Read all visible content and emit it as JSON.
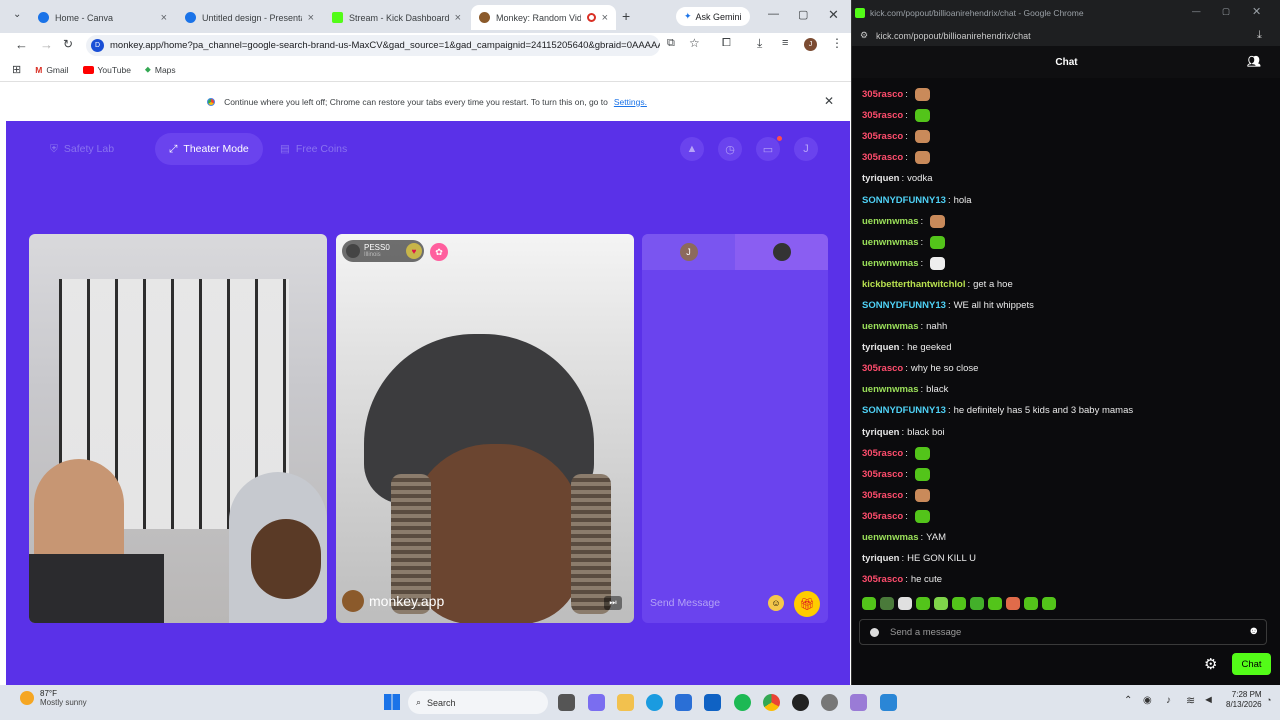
{
  "left_browser": {
    "tabs": [
      {
        "label": "Home - Canva",
        "color": "#1a73e8"
      },
      {
        "label": "Untitled design - Presentatio",
        "color": "#1a73e8"
      },
      {
        "label": "Stream - Kick Dashboard",
        "color": "#53fc18"
      },
      {
        "label": "Monkey: Random Video",
        "color": "#8b5a2b"
      }
    ],
    "new_tab": "+",
    "ask_gemini": "Ask Gemini",
    "url": "monkey.app/home?pa_channel=google-search-brand-us-MaxCV&gad_source=1&gad_campaignid=24115205640&gbraid=0AAAAA...",
    "bookmarks": [
      "Gmail",
      "YouTube",
      "Maps"
    ],
    "infobar": {
      "text": "Continue where you left off; Chrome can restore your tabs every time you restart. To turn this on, go to",
      "link": "Settings."
    }
  },
  "monkey": {
    "safety_lab": "Safety Lab",
    "theater_mode": "Theater Mode",
    "free_coins": "Free Coins",
    "avatar_letter": "J",
    "peer": {
      "name": "PESS0",
      "location": "Illinois"
    },
    "watermark": "monkey.app",
    "chat_avatar_letter": "J",
    "send_placeholder": "Send Message",
    "colors": {
      "bg": "#5a31e8",
      "panel": "#6a43ee"
    }
  },
  "kick": {
    "window_title": "kick.com/popout/billioanirehendrix/chat - Google Chrome",
    "address": "kick.com/popout/billioanirehendrix/chat",
    "header": "Chat",
    "messages": [
      {
        "user": "305rasco",
        "color": "#ff4d6d",
        "text": "",
        "emote": "#c98a5a"
      },
      {
        "user": "305rasco",
        "color": "#ff4d6d",
        "text": "",
        "emote": "#53c41a"
      },
      {
        "user": "305rasco",
        "color": "#ff4d6d",
        "text": "",
        "emote": "#c98a5a"
      },
      {
        "user": "305rasco",
        "color": "#ff4d6d",
        "text": "",
        "emote": "#c98a5a"
      },
      {
        "user": "tyriquen",
        "color": "#e6e6e6",
        "text": "vodka",
        "emote": ""
      },
      {
        "user": "SONNYDFUNNY13",
        "color": "#4fd1f5",
        "text": "hola",
        "emote": ""
      },
      {
        "user": "uenwnwmas",
        "color": "#9be05a",
        "text": "",
        "emote": "#c98a5a"
      },
      {
        "user": "uenwnwmas",
        "color": "#9be05a",
        "text": "",
        "emote": "#53c41a"
      },
      {
        "user": "uenwnwmas",
        "color": "#9be05a",
        "text": "",
        "emote": "#eeeeee"
      },
      {
        "user": "kickbetterthantwitchlol",
        "color": "#b8e04f",
        "text": "get a hoe",
        "emote": ""
      },
      {
        "user": "SONNYDFUNNY13",
        "color": "#4fd1f5",
        "text": "WE all hit whippets",
        "emote": ""
      },
      {
        "user": "uenwnwmas",
        "color": "#9be05a",
        "text": "nahh",
        "emote": ""
      },
      {
        "user": "tyriquen",
        "color": "#e6e6e6",
        "text": "he geeked",
        "emote": ""
      },
      {
        "user": "305rasco",
        "color": "#ff4d6d",
        "text": "why he so close",
        "emote": ""
      },
      {
        "user": "uenwnwmas",
        "color": "#9be05a",
        "text": "black",
        "emote": ""
      },
      {
        "user": "SONNYDFUNNY13",
        "color": "#4fd1f5",
        "text": "he definitely has 5 kids and 3 baby mamas",
        "emote": ""
      },
      {
        "user": "tyriquen",
        "color": "#e6e6e6",
        "text": "black boi",
        "emote": ""
      },
      {
        "user": "305rasco",
        "color": "#ff4d6d",
        "text": "",
        "emote": "#53c41a"
      },
      {
        "user": "305rasco",
        "color": "#ff4d6d",
        "text": "",
        "emote": "#53c41a"
      },
      {
        "user": "305rasco",
        "color": "#ff4d6d",
        "text": "",
        "emote": "#c98a5a"
      },
      {
        "user": "305rasco",
        "color": "#ff4d6d",
        "text": "",
        "emote": "#53c41a"
      },
      {
        "user": "uenwnwmas",
        "color": "#9be05a",
        "text": "YAM",
        "emote": ""
      },
      {
        "user": "tyriquen",
        "color": "#e6e6e6",
        "text": "HE GON KILL U",
        "emote": ""
      },
      {
        "user": "305rasco",
        "color": "#ff4d6d",
        "text": "he cute",
        "emote": ""
      }
    ],
    "send_placeholder": "Send a message",
    "chat_button": "Chat"
  },
  "taskbar": {
    "weather_temp": "87°F",
    "weather_desc": "Mostly sunny",
    "search": "Search",
    "time": "7:28 PM",
    "date": "8/13/2026"
  }
}
